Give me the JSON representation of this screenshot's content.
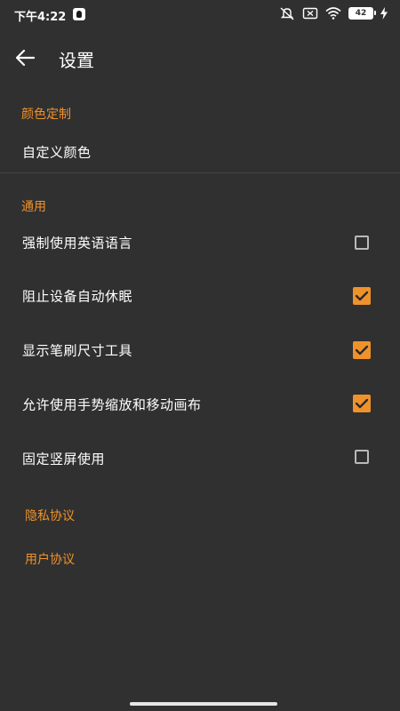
{
  "status_bar": {
    "time": "下午4:22",
    "battery_level": "42",
    "icons": [
      "qq-icon",
      "mute-icon",
      "sim-off-icon",
      "wifi-icon",
      "battery-icon",
      "charging-icon"
    ]
  },
  "app_bar": {
    "title": "设置"
  },
  "sections": {
    "color": {
      "header": "颜色定制",
      "custom_color": "自定义颜色"
    },
    "general": {
      "header": "通用",
      "items": [
        {
          "label": "强制使用英语语言",
          "checked": false
        },
        {
          "label": "阻止设备自动休眠",
          "checked": true
        },
        {
          "label": "显示笔刷尺寸工具",
          "checked": true
        },
        {
          "label": "允许使用手势缩放和移动画布",
          "checked": true
        },
        {
          "label": "固定竖屏使用",
          "checked": false
        }
      ]
    },
    "links": {
      "privacy": "隐私协议",
      "user_agreement": "用户协议"
    }
  },
  "colors": {
    "accent": "#f0922b",
    "background": "#303030"
  }
}
